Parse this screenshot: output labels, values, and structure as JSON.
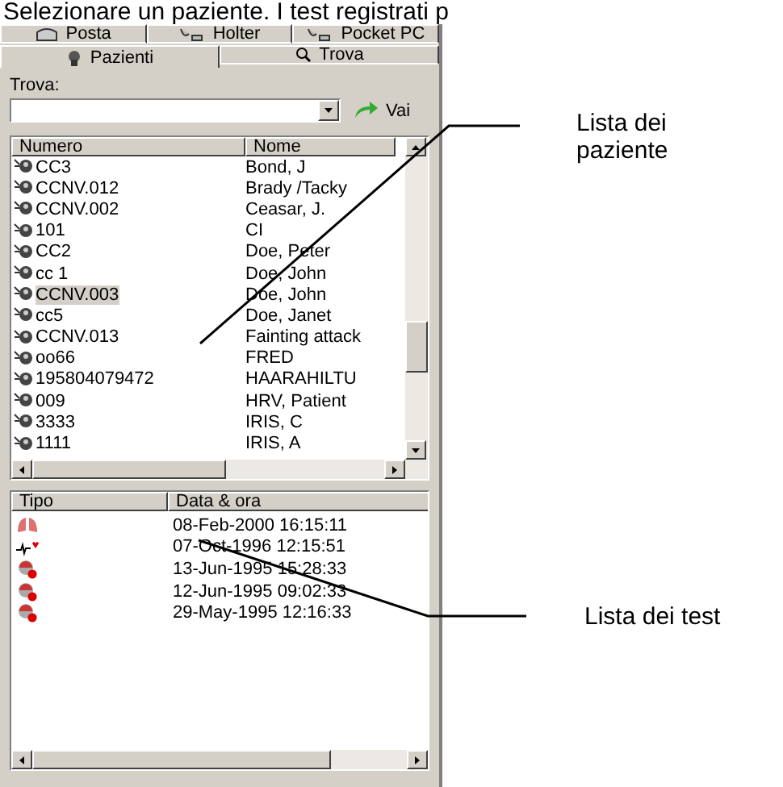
{
  "heading": "Selezionare un paziente. I test registrati p",
  "tab_rows": [
    [
      {
        "label": "Posta",
        "kind": "mail",
        "selected": false
      },
      {
        "label": "Holter",
        "kind": "device",
        "selected": false
      },
      {
        "label": "Pocket PC",
        "kind": "device",
        "selected": false
      }
    ],
    [
      {
        "label": "Pazienti",
        "kind": "patient",
        "selected": true
      },
      {
        "label": "Trova",
        "kind": "search",
        "selected": false
      }
    ]
  ],
  "search": {
    "label": "Trova:",
    "go_button": "Vai"
  },
  "patients": {
    "columns": [
      "Numero",
      "Nome"
    ],
    "rows": [
      {
        "number": "CC3",
        "name": "Bond, J",
        "selected": false
      },
      {
        "number": "CCNV.012",
        "name": "Brady /Tacky",
        "selected": false
      },
      {
        "number": "CCNV.002",
        "name": "Ceasar, J.",
        "selected": false
      },
      {
        "number": "101",
        "name": "CI",
        "selected": false
      },
      {
        "number": "CC2",
        "name": "Doe, Peter",
        "selected": false
      },
      {
        "number": "cc 1",
        "name": "Doe, John",
        "selected": false
      },
      {
        "number": "CCNV.003",
        "name": "Doe, John",
        "selected": true
      },
      {
        "number": "cc5",
        "name": "Doe, Janet",
        "selected": false
      },
      {
        "number": "CCNV.013",
        "name": "Fainting attack",
        "selected": false
      },
      {
        "number": "oo66",
        "name": "FRED",
        "selected": false
      },
      {
        "number": "195804079472",
        "name": "HAARAHILTU",
        "selected": false
      },
      {
        "number": "009",
        "name": "HRV, Patient",
        "selected": false
      },
      {
        "number": "3333",
        "name": "IRIS, C",
        "selected": false
      },
      {
        "number": "1111",
        "name": "IRIS, A",
        "selected": false
      }
    ]
  },
  "tests": {
    "columns": [
      "Tipo",
      "Data & ora"
    ],
    "rows": [
      {
        "kind": "lungs",
        "date": "08-Feb-2000 16:15:11"
      },
      {
        "kind": "ecg",
        "date": "07-Oct-1996 12:15:51"
      },
      {
        "kind": "holter",
        "date": "13-Jun-1995 15:28:33"
      },
      {
        "kind": "holter",
        "date": "12-Jun-1995 09:02:33"
      },
      {
        "kind": "holter",
        "date": "29-May-1995 12:16:33"
      }
    ]
  },
  "callouts": [
    "Lista dei paziente",
    "Lista dei test"
  ]
}
